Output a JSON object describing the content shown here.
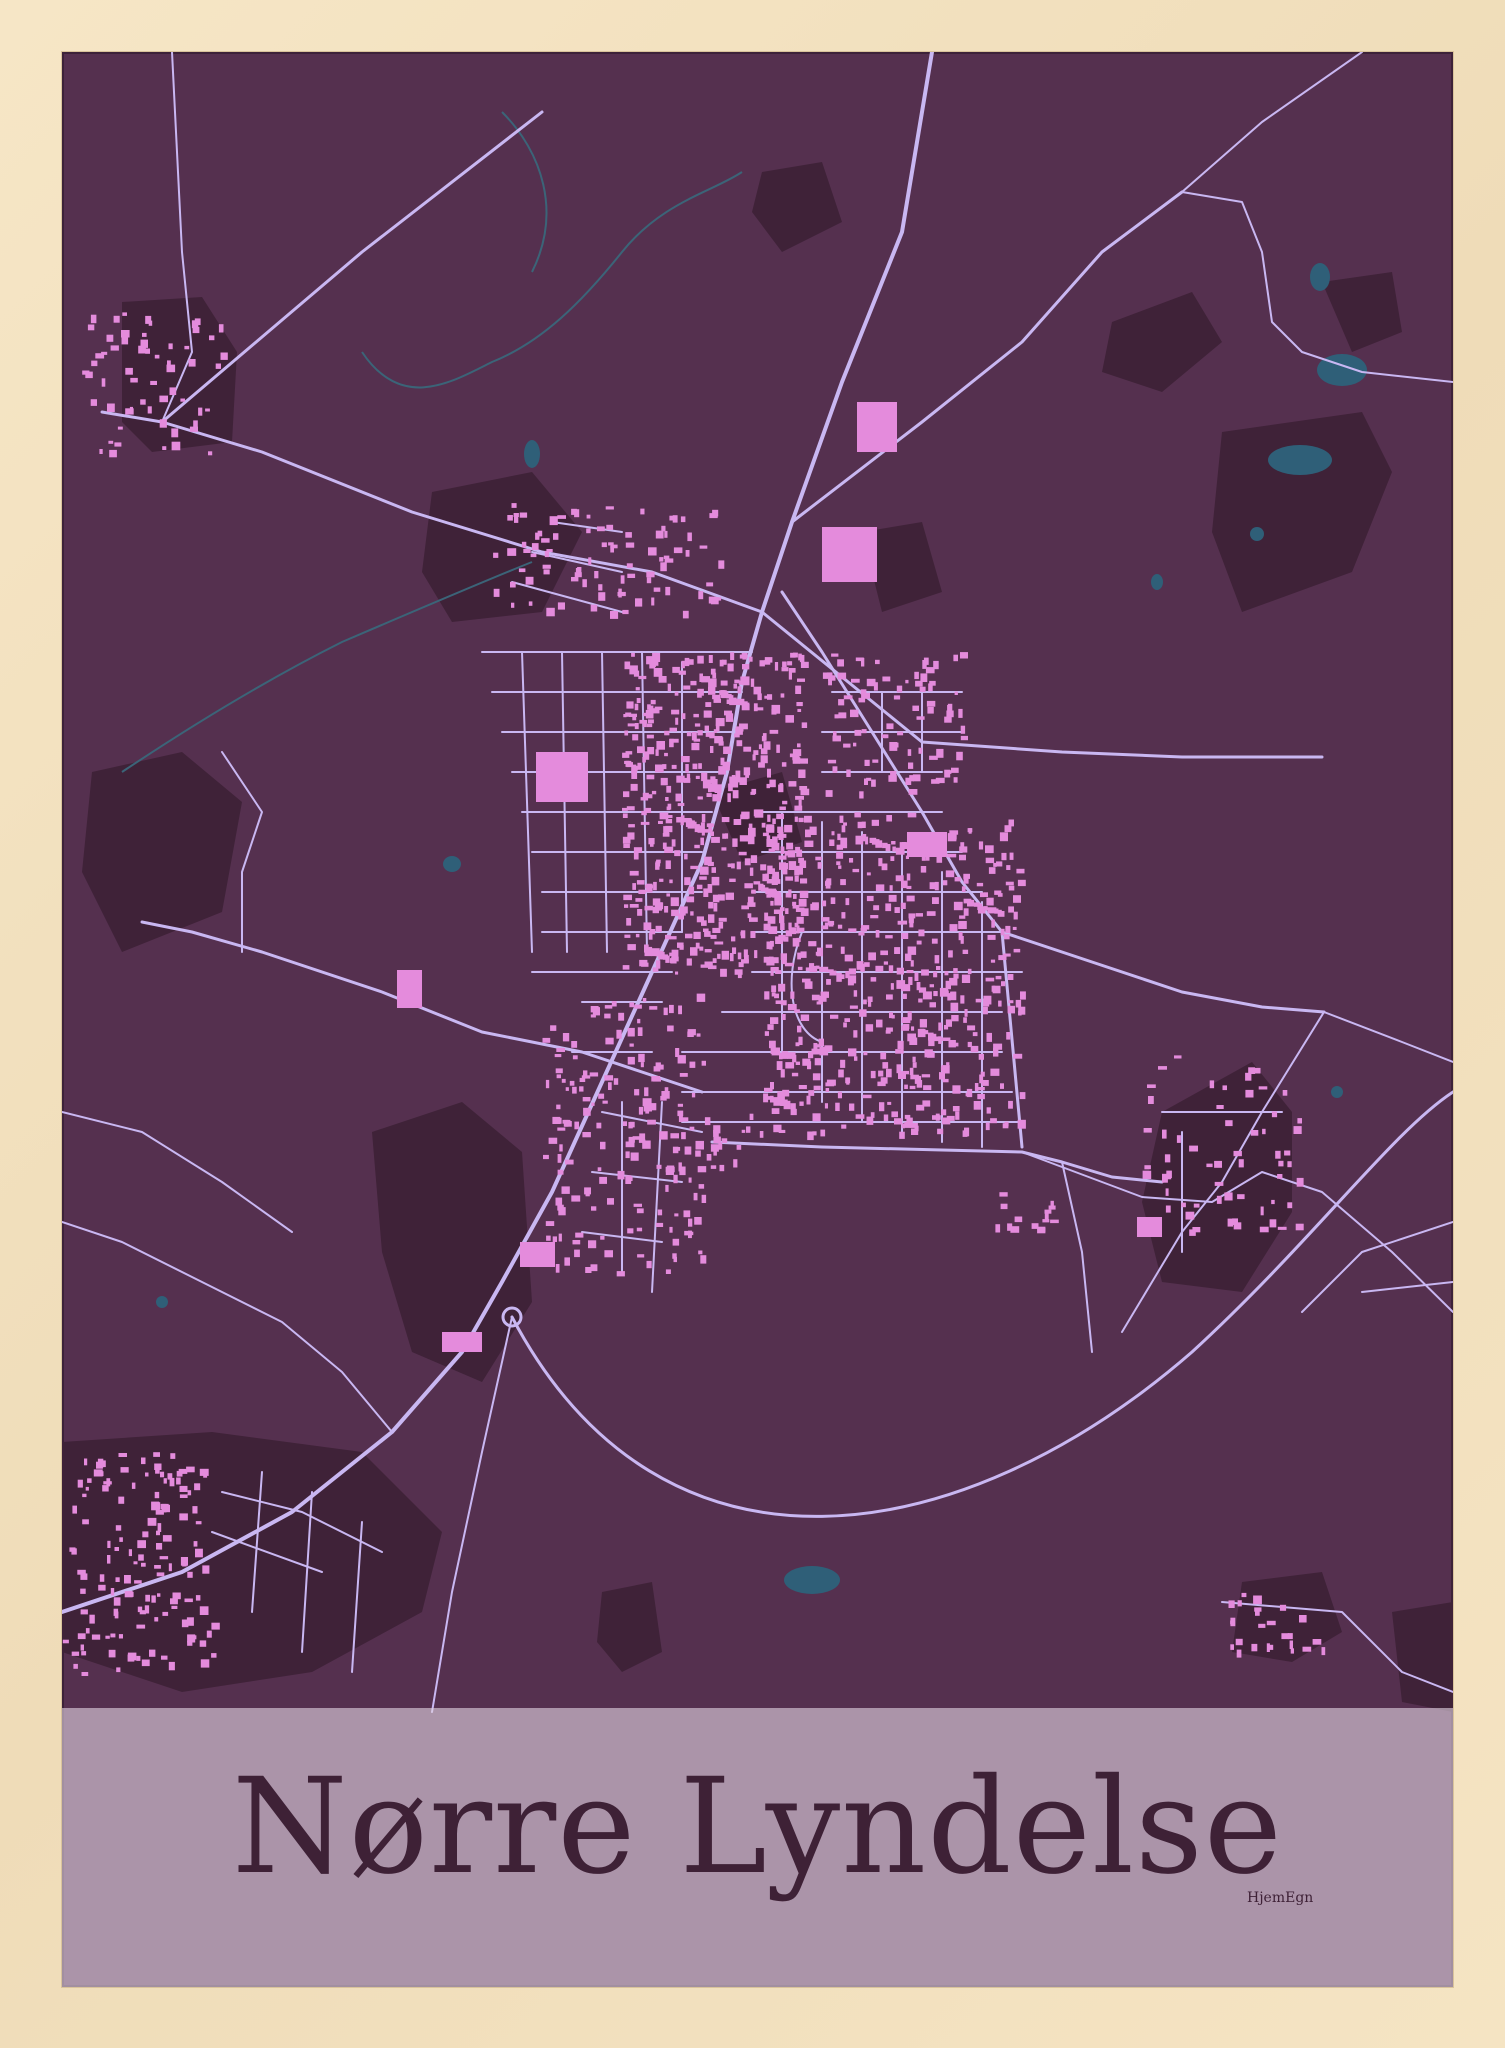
{
  "poster": {
    "title": "Nørre Lyndelse",
    "credit": "HjemEgn"
  },
  "colors": {
    "frame": "#f3e2c1",
    "land": "#55304f",
    "dark_areas": "#3f2238",
    "roads": "#c9b7f2",
    "buildings": "#e48bdc",
    "water": "#2f5f78",
    "band": "#e1d2e1",
    "title": "#3e2136"
  }
}
